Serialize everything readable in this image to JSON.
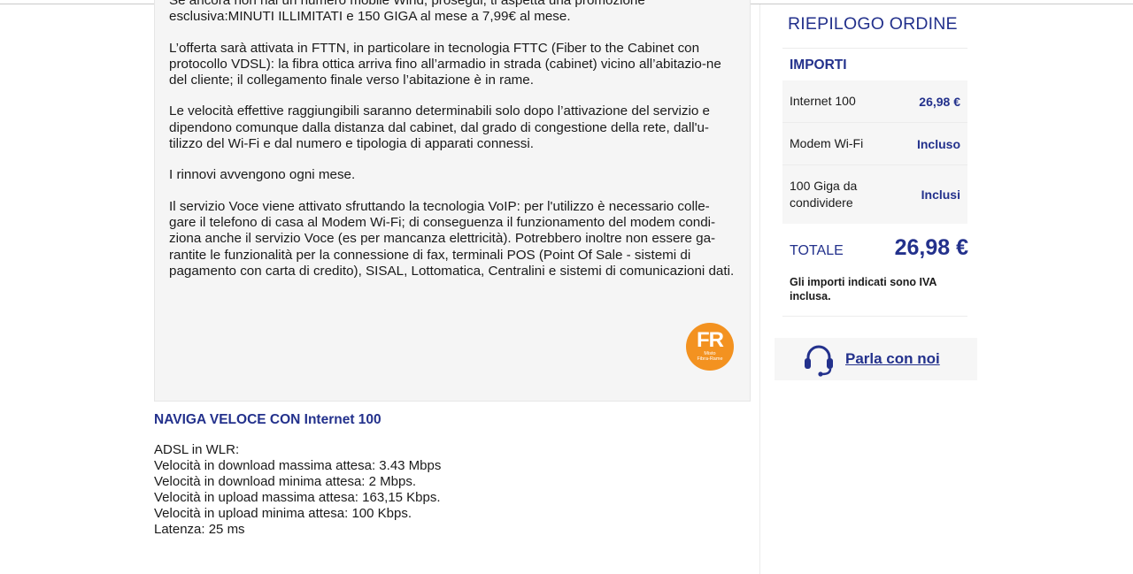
{
  "offer": {
    "paragraphs": [
      "Se ancora non hai un numero mobile Wind, prosegui, ti aspetta una promozione esclusiva:MINUTI ILLIMITATI e 150 GIGA al mese a 7,99€ al mese.",
      "L’offerta sarà attivata in FTTN, in particolare in tecnologia FTTC (Fiber to the Cabinet con protocollo VDSL): la fibra ottica arriva fino all’armadio in strada (cabinet) vicino all’abitazio-ne del cliente; il collegamento finale verso l’abitazione è in rame.",
      "Le velocità effettive raggiungibili saranno determinabili solo dopo l’attivazione del servizio e dipendono comunque dalla distanza dal cabinet, dal grado di congestione della rete, dall'u-tilizzo del Wi-Fi e dal numero e tipologia di apparati connessi.",
      "I rinnovi avvengono ogni mese.",
      "Il servizio Voce viene attivato sfruttando la tecnologia VoIP: per l'utilizzo è necessario colle-gare il telefono di casa al Modem Wi-Fi; di conseguenza il funzionamento del modem condi-ziona anche il servizio Voce (es per mancanza elettricità). Potrebbero inoltre non essere ga-rantite le funzionalità per la connessione di fax, terminali POS (Point Of Sale - sistemi di pagamento con carta di credito), SISAL, Lottomatica, Centralini e sistemi di comunicazioni dati."
    ],
    "badge": {
      "code": "FR",
      "caption_line1": "Misto",
      "caption_line2": "Fibra-Rame",
      "color": "#f39220"
    }
  },
  "speed": {
    "title": "NAVIGA VELOCE CON Internet 100",
    "lines": [
      "ADSL in WLR:",
      "Velocità in download massima attesa: 3.43 Mbps",
      "Velocità in download minima attesa: 2 Mbps.",
      "Velocità in upload massima attesa: 163,15 Kbps.",
      "Velocità in upload minima attesa: 100 Kbps.",
      "Latenza: 25 ms"
    ]
  },
  "summary": {
    "title": "RIEPILOGO ORDINE",
    "section": "IMPORTI",
    "rows": [
      {
        "label": "Internet 100",
        "value": "26,98 €"
      },
      {
        "label": "Modem Wi-Fi",
        "value": "Incluso"
      },
      {
        "label": "100 Giga da condividere",
        "value": "Inclusi"
      }
    ],
    "total_label": "TOTALE",
    "total_value": "26,98 €",
    "note": "Gli importi indicati sono IVA inclusa."
  },
  "contact": {
    "label": "Parla con noi",
    "icon": "headset-icon"
  },
  "colors": {
    "brand": "#23318c",
    "badge": "#f39220",
    "panel": "#f5f5f5"
  }
}
